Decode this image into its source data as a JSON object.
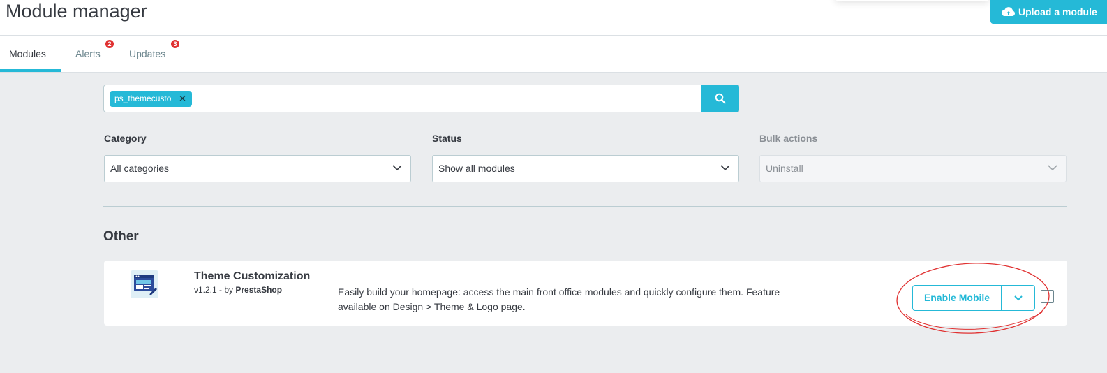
{
  "header": {
    "title": "Module manager",
    "upload_label": "Upload a module"
  },
  "tabs": [
    {
      "label": "Modules",
      "active": true
    },
    {
      "label": "Alerts",
      "badge": "2"
    },
    {
      "label": "Updates",
      "badge": "3"
    }
  ],
  "search": {
    "tag": "ps_themecusto",
    "placeholder": ""
  },
  "filters": {
    "category": {
      "label": "Category",
      "value": "All categories"
    },
    "status": {
      "label": "Status",
      "value": "Show all modules"
    },
    "bulk": {
      "label": "Bulk actions",
      "value": "Uninstall"
    }
  },
  "section": {
    "title": "Other"
  },
  "module": {
    "name": "Theme Customization",
    "version": "v1.2.1 - by ",
    "author": "PrestaShop",
    "description": "Easily build your homepage: access the main front office modules and quickly configure them. Feature available on Design > Theme & Logo page.",
    "action_label": "Enable Mobile"
  },
  "colors": {
    "accent": "#25b9d7",
    "badge": "#e03131",
    "annotation": "#e03131"
  }
}
